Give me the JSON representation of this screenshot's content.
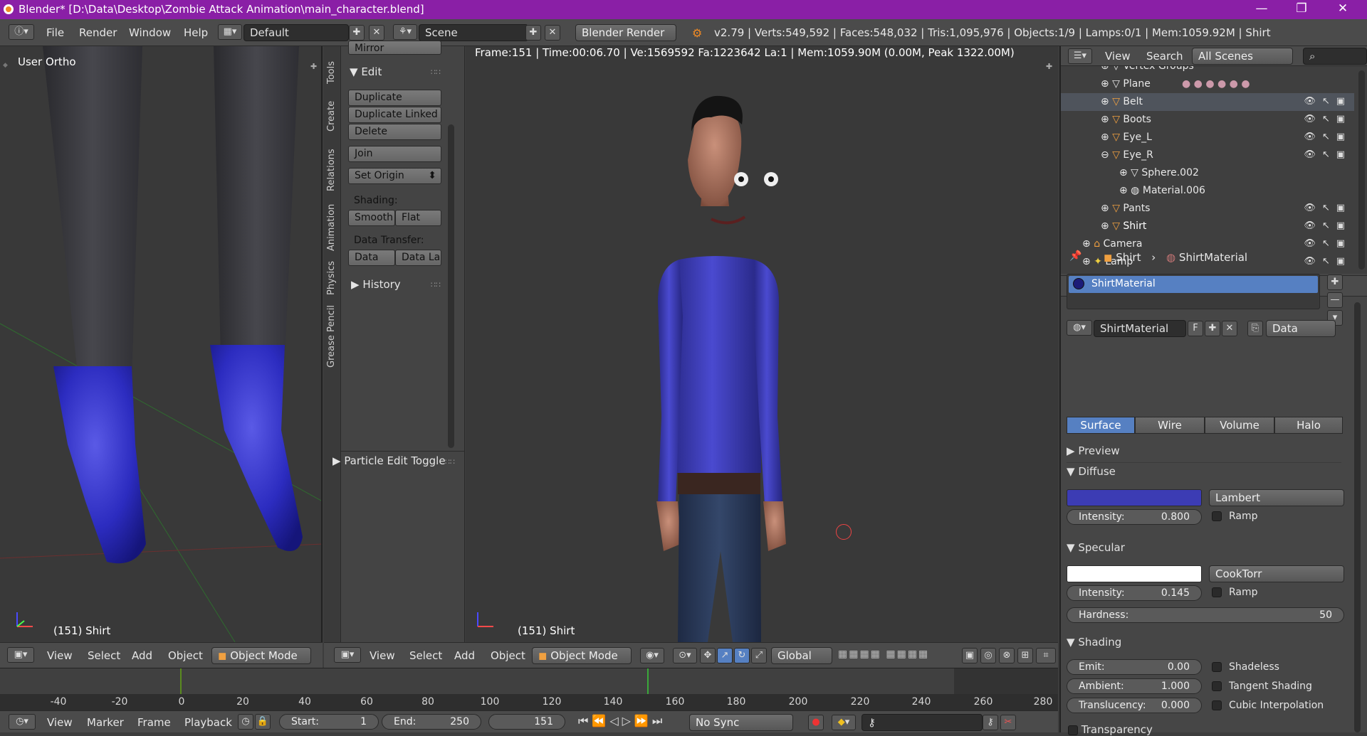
{
  "window": {
    "title": "Blender* [D:\\Data\\Desktop\\Zombie Attack Animation\\main_character.blend]",
    "minimize": "—",
    "maximize": "❐",
    "close": "✕"
  },
  "info_header": {
    "menus": [
      "File",
      "Render",
      "Window",
      "Help"
    ],
    "layout": "Default",
    "scene": "Scene",
    "engine": "Blender Render",
    "stats": "v2.79 | Verts:549,592 | Faces:548,032 | Tris:1,095,976 | Objects:1/9 | Lamps:0/1 | Mem:1059.92M | Shirt"
  },
  "viewport_left": {
    "view_name": "User Ortho",
    "object_label": "(151) Shirt"
  },
  "tool_shelf": {
    "tabs": [
      "Tools",
      "Create",
      "Relations",
      "Animation",
      "Physics",
      "Grease Pencil"
    ],
    "mirror_label": "Mirror",
    "edit_header": "Edit",
    "buttons": [
      "Duplicate",
      "Duplicate Linked",
      "Delete"
    ],
    "join_label": "Join",
    "set_origin_label": "Set Origin",
    "shading_label": "Shading:",
    "smooth_label": "Smooth",
    "flat_label": "Flat",
    "data_transfer_label": "Data Transfer:",
    "data_label": "Data",
    "data_la_label": "Data La",
    "history_header": "History",
    "particle_header": "Particle Edit Toggle"
  },
  "viewport_main": {
    "info": "Frame:151 | Time:00:06.70 | Ve:1569592 Fa:1223642 La:1 | Mem:1059.90M (0.00M, Peak 1322.00M)",
    "object_label": "(151) Shirt"
  },
  "outliner": {
    "view_label": "View",
    "search_label": "Search",
    "scene_filter": "All Scenes",
    "rows": [
      {
        "name": "Vertex Groups",
        "selected": false
      },
      {
        "name": "Plane",
        "selected": false
      },
      {
        "name": "Belt",
        "selected": true
      },
      {
        "name": "Boots",
        "selected": false
      },
      {
        "name": "Eye_L",
        "selected": false
      },
      {
        "name": "Eye_R",
        "selected": false
      },
      {
        "name": "Sphere.002",
        "selected": false
      },
      {
        "name": "Material.006",
        "selected": false
      },
      {
        "name": "Pants",
        "selected": false
      },
      {
        "name": "Shirt",
        "selected": false
      },
      {
        "name": "Camera",
        "selected": false
      },
      {
        "name": "Lamp",
        "selected": false
      }
    ]
  },
  "properties": {
    "breadcrumb_object": "Shirt",
    "breadcrumb_material": "ShirtMaterial",
    "slot_material": "ShirtMaterial",
    "material_name": "ShirtMaterial",
    "fake_user": "F",
    "link_mode": "Data",
    "tabs": [
      "Surface",
      "Wire",
      "Volume",
      "Halo"
    ],
    "active_tab": "Surface",
    "preview_header": "Preview",
    "diffuse_header": "Diffuse",
    "diffuse_color": "#3c3cb4",
    "diffuse_shader": "Lambert",
    "diffuse_intensity_label": "Intensity:",
    "diffuse_intensity": "0.800",
    "ramp_label": "Ramp",
    "specular_header": "Specular",
    "specular_color": "#ffffff",
    "specular_shader": "CookTorr",
    "specular_intensity_label": "Intensity:",
    "specular_intensity": "0.145",
    "hardness_label": "Hardness:",
    "hardness": "50",
    "shading_header": "Shading",
    "emit_label": "Emit:",
    "emit": "0.00",
    "ambient_label": "Ambient:",
    "ambient": "1.000",
    "translucency_label": "Translucency:",
    "translucency": "0.000",
    "shadeless_label": "Shadeless",
    "tangent_label": "Tangent Shading",
    "cubic_label": "Cubic Interpolation",
    "transparency_header": "Transparency"
  },
  "view3d_header": {
    "menus": [
      "View",
      "Select",
      "Add",
      "Object"
    ],
    "mode": "Object Mode",
    "orientation": "Global"
  },
  "timeline": {
    "ticks": [
      "-40",
      "-20",
      "0",
      "20",
      "40",
      "60",
      "80",
      "100",
      "120",
      "140",
      "160",
      "180",
      "200",
      "220",
      "240",
      "260",
      "280"
    ],
    "current_frame_marker": 151,
    "menus": [
      "View",
      "Marker",
      "Frame",
      "Playback"
    ],
    "start_label": "Start:",
    "start": "1",
    "end_label": "End:",
    "end": "250",
    "current_frame": "151",
    "sync": "No Sync"
  }
}
